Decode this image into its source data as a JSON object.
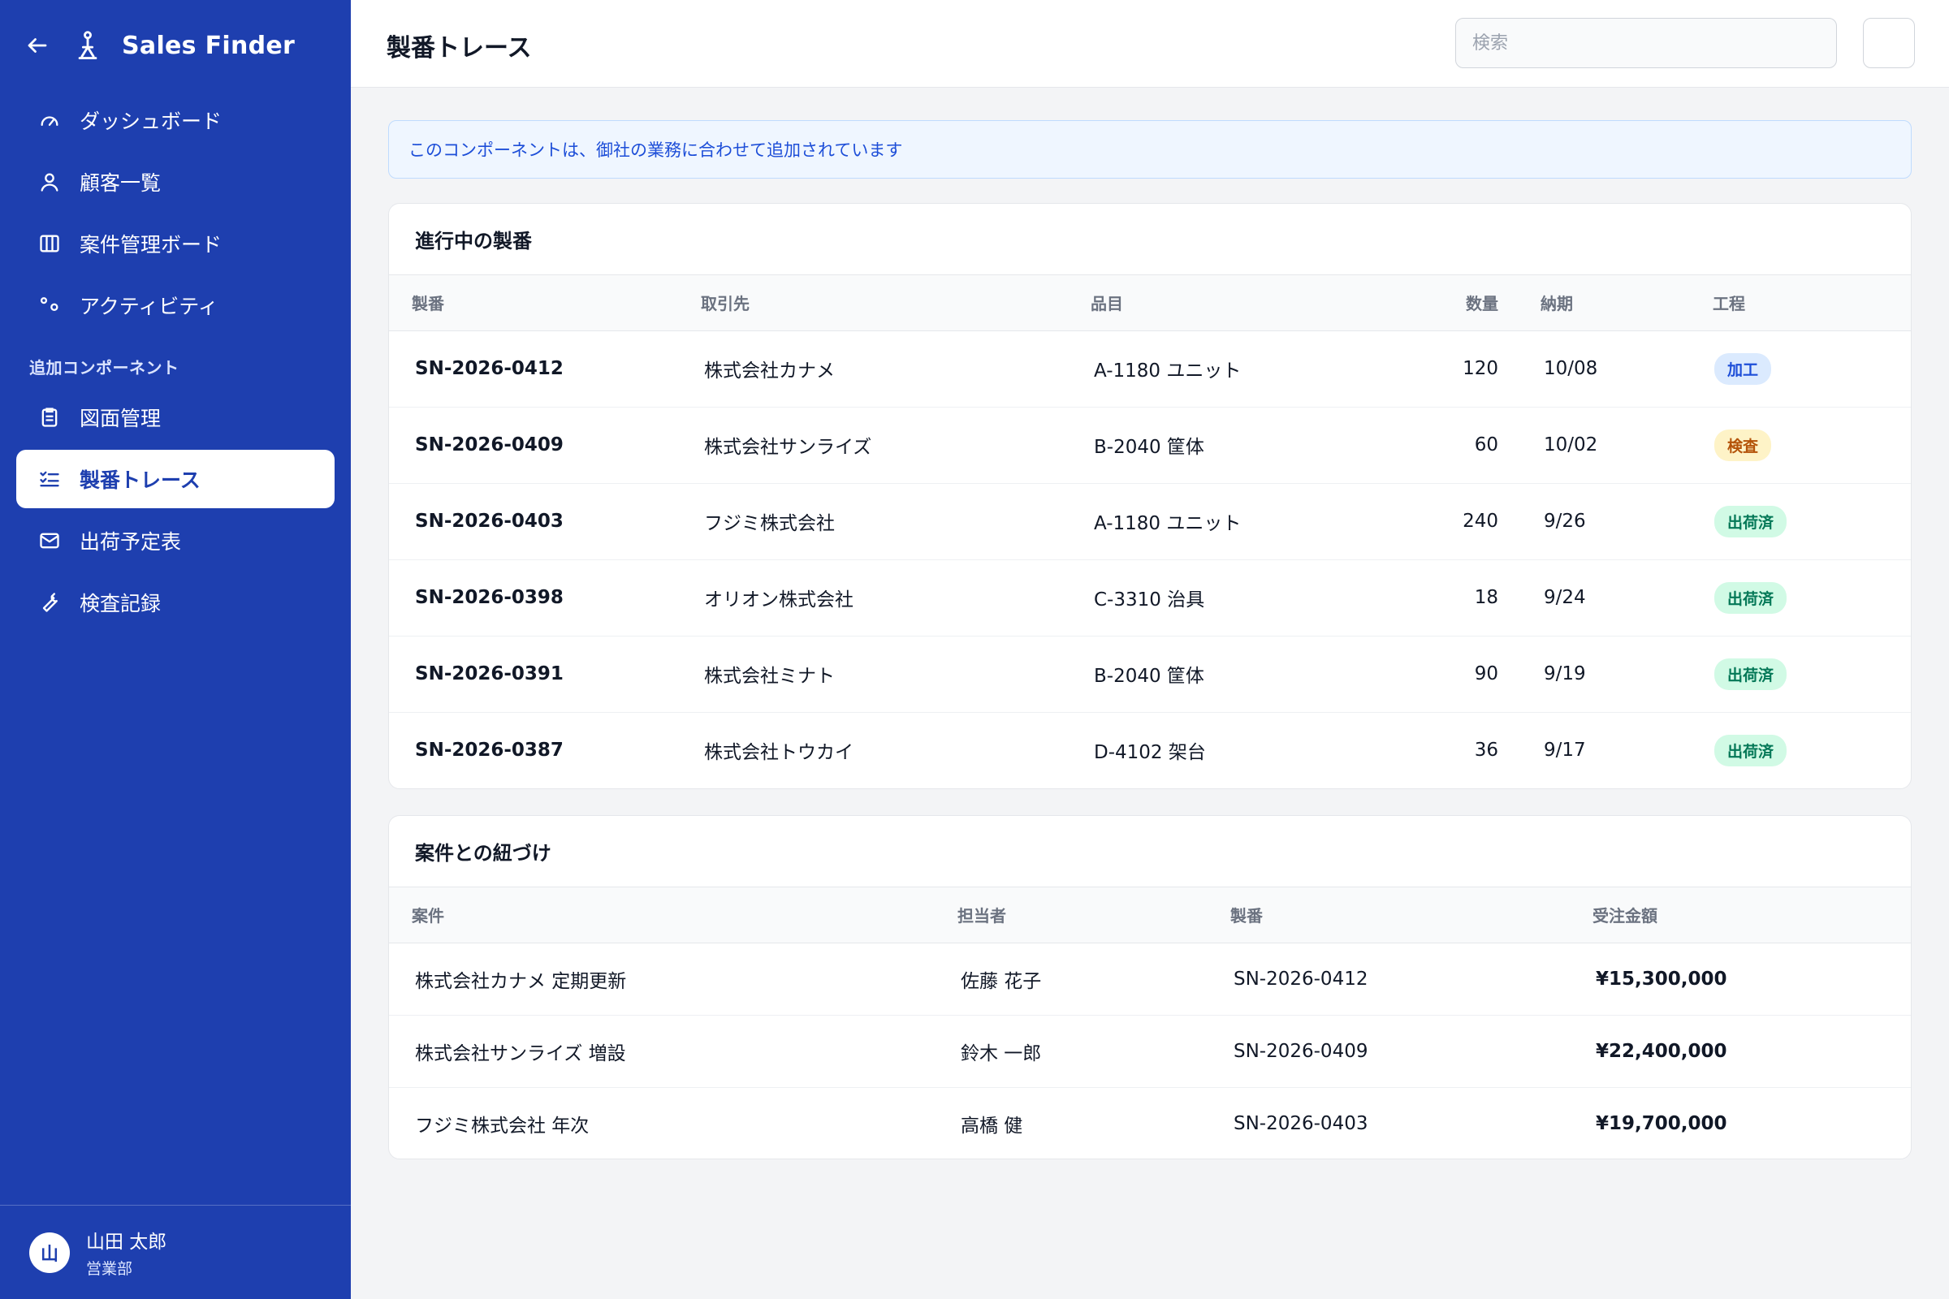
{
  "app": {
    "title": "Sales Finder"
  },
  "sidebar": {
    "items": [
      {
        "label": "ダッシュボード",
        "icon": "gauge-icon"
      },
      {
        "label": "顧客一覧",
        "icon": "user-icon"
      },
      {
        "label": "案件管理ボード",
        "icon": "columns-icon"
      },
      {
        "label": "アクティビティ",
        "icon": "activity-icon"
      }
    ],
    "section_label": "追加コンポーネント",
    "extra_items": [
      {
        "label": "図面管理",
        "icon": "clipboard-icon"
      },
      {
        "label": "製番トレース",
        "icon": "checklist-icon",
        "active": true
      },
      {
        "label": "出荷予定表",
        "icon": "mail-icon"
      },
      {
        "label": "検査記録",
        "icon": "wrench-icon"
      }
    ],
    "user": {
      "avatar": "山",
      "name": "山田 太郎",
      "dept": "営業部"
    }
  },
  "header": {
    "title": "製番トレース",
    "search_placeholder": "検索"
  },
  "notice": "このコンポーネントは、御社の業務に合わせて追加されています",
  "active_orders": {
    "title": "進行中の製番",
    "columns": [
      "製番",
      "取引先",
      "品目",
      "数量",
      "納期",
      "工程"
    ],
    "rows": [
      {
        "id": "SN-2026-0412",
        "customer": "株式会社カナメ",
        "item": "A-1180 ユニット",
        "qty": "120",
        "due": "10/08",
        "stage": "加工",
        "stage_color": "#1d4ed8"
      },
      {
        "id": "SN-2026-0409",
        "customer": "株式会社サンライズ",
        "item": "B-2040 筐体",
        "qty": "60",
        "due": "10/02",
        "stage": "検査",
        "stage_color": "#b45309"
      },
      {
        "id": "SN-2026-0403",
        "customer": "フジミ株式会社",
        "item": "A-1180 ユニット",
        "qty": "240",
        "due": "9/26",
        "stage": "出荷済",
        "stage_color": "#047857"
      },
      {
        "id": "SN-2026-0398",
        "customer": "オリオン株式会社",
        "item": "C-3310 治具",
        "qty": "18",
        "due": "9/24",
        "stage": "出荷済",
        "stage_color": "#047857"
      },
      {
        "id": "SN-2026-0391",
        "customer": "株式会社ミナト",
        "item": "B-2040 筐体",
        "qty": "90",
        "due": "9/19",
        "stage": "出荷済",
        "stage_color": "#047857"
      },
      {
        "id": "SN-2026-0387",
        "customer": "株式会社トウカイ",
        "item": "D-4102 架台",
        "qty": "36",
        "due": "9/17",
        "stage": "出荷済",
        "stage_color": "#047857"
      }
    ]
  },
  "links": {
    "title": "案件との紐づけ",
    "columns": [
      "案件",
      "担当者",
      "製番",
      "受注金額"
    ],
    "rows": [
      {
        "deal": "株式会社カナメ 定期更新",
        "owner": "佐藤 花子",
        "id": "SN-2026-0412",
        "amount": "¥15,300,000"
      },
      {
        "deal": "株式会社サンライズ 増設",
        "owner": "鈴木 一郎",
        "id": "SN-2026-0409",
        "amount": "¥22,400,000"
      },
      {
        "deal": "フジミ株式会社 年次",
        "owner": "高橋 健",
        "id": "SN-2026-0403",
        "amount": "¥19,700,000"
      }
    ]
  }
}
